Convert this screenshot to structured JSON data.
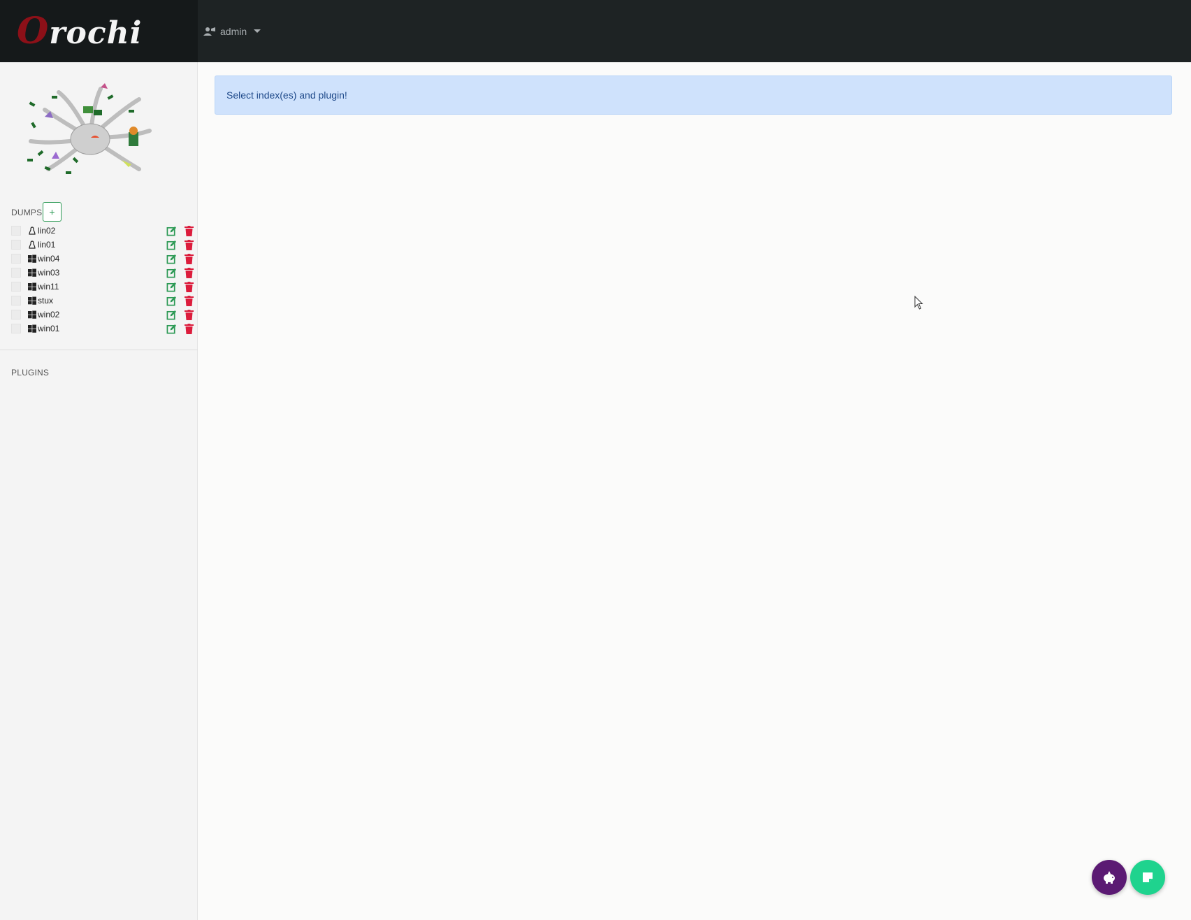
{
  "brand": {
    "logo_first": "O",
    "logo_rest": "rochi"
  },
  "user_menu": {
    "label": "admin",
    "icon": "user-icon"
  },
  "sidebar": {
    "dumps_title": "DUMPS",
    "add_label": "+",
    "dumps": [
      {
        "name": "lin02",
        "os": "linux"
      },
      {
        "name": "lin01",
        "os": "linux"
      },
      {
        "name": "win04",
        "os": "windows"
      },
      {
        "name": "win03",
        "os": "windows"
      },
      {
        "name": "win11",
        "os": "windows"
      },
      {
        "name": "stux",
        "os": "windows"
      },
      {
        "name": "win02",
        "os": "windows"
      },
      {
        "name": "win01",
        "os": "windows"
      }
    ],
    "plugins_title": "PLUGINS"
  },
  "main": {
    "alert_text": "Select index(es) and plugin!"
  },
  "colors": {
    "navbar": "#1e2324",
    "brand_bg": "#15191a",
    "alert_bg": "#cfe2fc",
    "edit": "#2d9a55",
    "delete": "#dc1c3c",
    "fab_purple": "#5b1a73",
    "fab_green": "#1fd38e"
  }
}
